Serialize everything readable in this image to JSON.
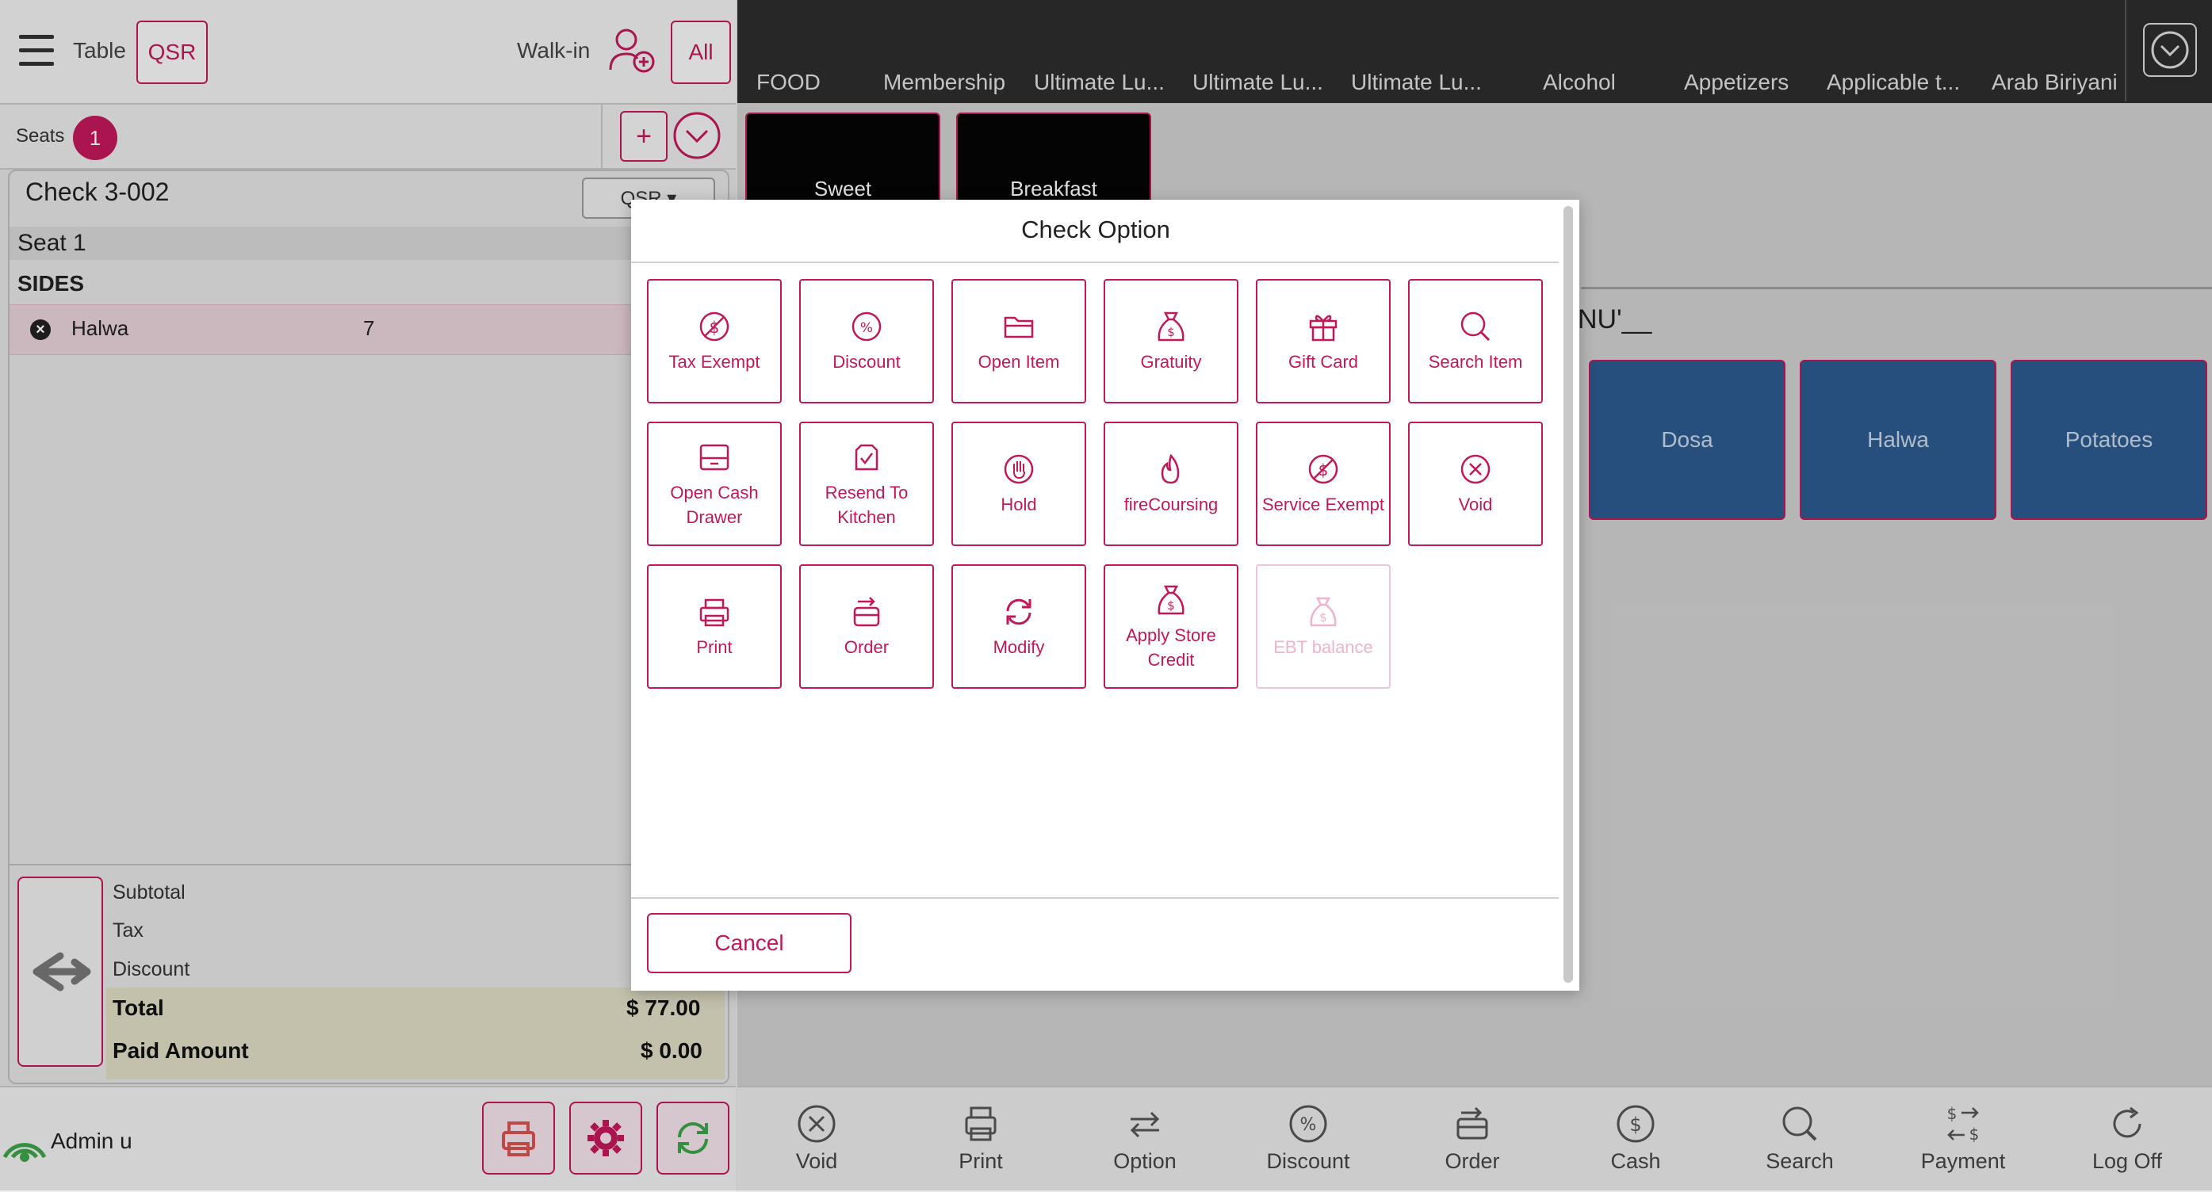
{
  "topbar": {
    "table_label": "Table",
    "qsr_button": "QSR",
    "walkin_label": "Walk-in",
    "all_button": "All"
  },
  "seats": {
    "label": "Seats",
    "count": "1",
    "add_symbol": "+"
  },
  "check": {
    "title": "Check 3-002",
    "type_dropdown": "QSR ▾",
    "seat_label": "Seat 1",
    "group_label": "SIDES",
    "items": [
      {
        "name": "Halwa",
        "qty": "7"
      }
    ]
  },
  "totals": {
    "subtotal_label": "Subtotal",
    "tax_label": "Tax",
    "discount_label": "Discount",
    "total_label": "Total",
    "total_value": "$ 77.00",
    "paid_label": "Paid Amount",
    "paid_value": "$ 0.00"
  },
  "footer_left": {
    "user": "Admin u"
  },
  "categories": [
    "FOOD",
    "Membership",
    "Ultimate Lu...",
    "Ultimate Lu...",
    "Ultimate Lu...",
    "Alcohol",
    "Appetizers",
    "Applicable t...",
    "Arab Biriyani"
  ],
  "subcategories": [
    "Sweet",
    "Breakfast"
  ],
  "menu": {
    "name_partial": "NU'__",
    "items": [
      "Dosa",
      "Halwa",
      "Potatoes"
    ]
  },
  "actions": [
    "Void",
    "Print",
    "Option",
    "Discount",
    "Order",
    "Cash",
    "Search",
    "Payment",
    "Log Off"
  ],
  "modal": {
    "title": "Check Option",
    "options": [
      {
        "label": "Tax Exempt",
        "icon": "tax-exempt-icon",
        "enabled": true
      },
      {
        "label": "Discount",
        "icon": "discount-icon",
        "enabled": true
      },
      {
        "label": "Open Item",
        "icon": "folder-icon",
        "enabled": true
      },
      {
        "label": "Gratuity",
        "icon": "money-bag-icon",
        "enabled": true
      },
      {
        "label": "Gift Card",
        "icon": "gift-icon",
        "enabled": true
      },
      {
        "label": "Search Item",
        "icon": "search-icon",
        "enabled": true
      },
      {
        "label": "Open Cash Drawer",
        "icon": "cash-drawer-icon",
        "enabled": true
      },
      {
        "label": "Resend To Kitchen",
        "icon": "resend-icon",
        "enabled": true
      },
      {
        "label": "Hold",
        "icon": "hand-icon",
        "enabled": true
      },
      {
        "label": "fireCoursing",
        "icon": "fire-icon",
        "enabled": true
      },
      {
        "label": "Service Exempt",
        "icon": "service-exempt-icon",
        "enabled": true
      },
      {
        "label": "Void",
        "icon": "void-icon",
        "enabled": true
      },
      {
        "label": "Print",
        "icon": "printer-icon",
        "enabled": true
      },
      {
        "label": "Order",
        "icon": "order-icon",
        "enabled": true
      },
      {
        "label": "Modify",
        "icon": "refresh-icon",
        "enabled": true
      },
      {
        "label": "Apply Store Credit",
        "icon": "money-bag-icon",
        "enabled": true
      },
      {
        "label": "EBT balance",
        "icon": "money-bag-icon",
        "enabled": false
      }
    ],
    "cancel_label": "Cancel"
  },
  "colors": {
    "accent": "#c2185b",
    "tile_blue": "#2c5b8f",
    "category_bar": "#2d2d2d"
  }
}
